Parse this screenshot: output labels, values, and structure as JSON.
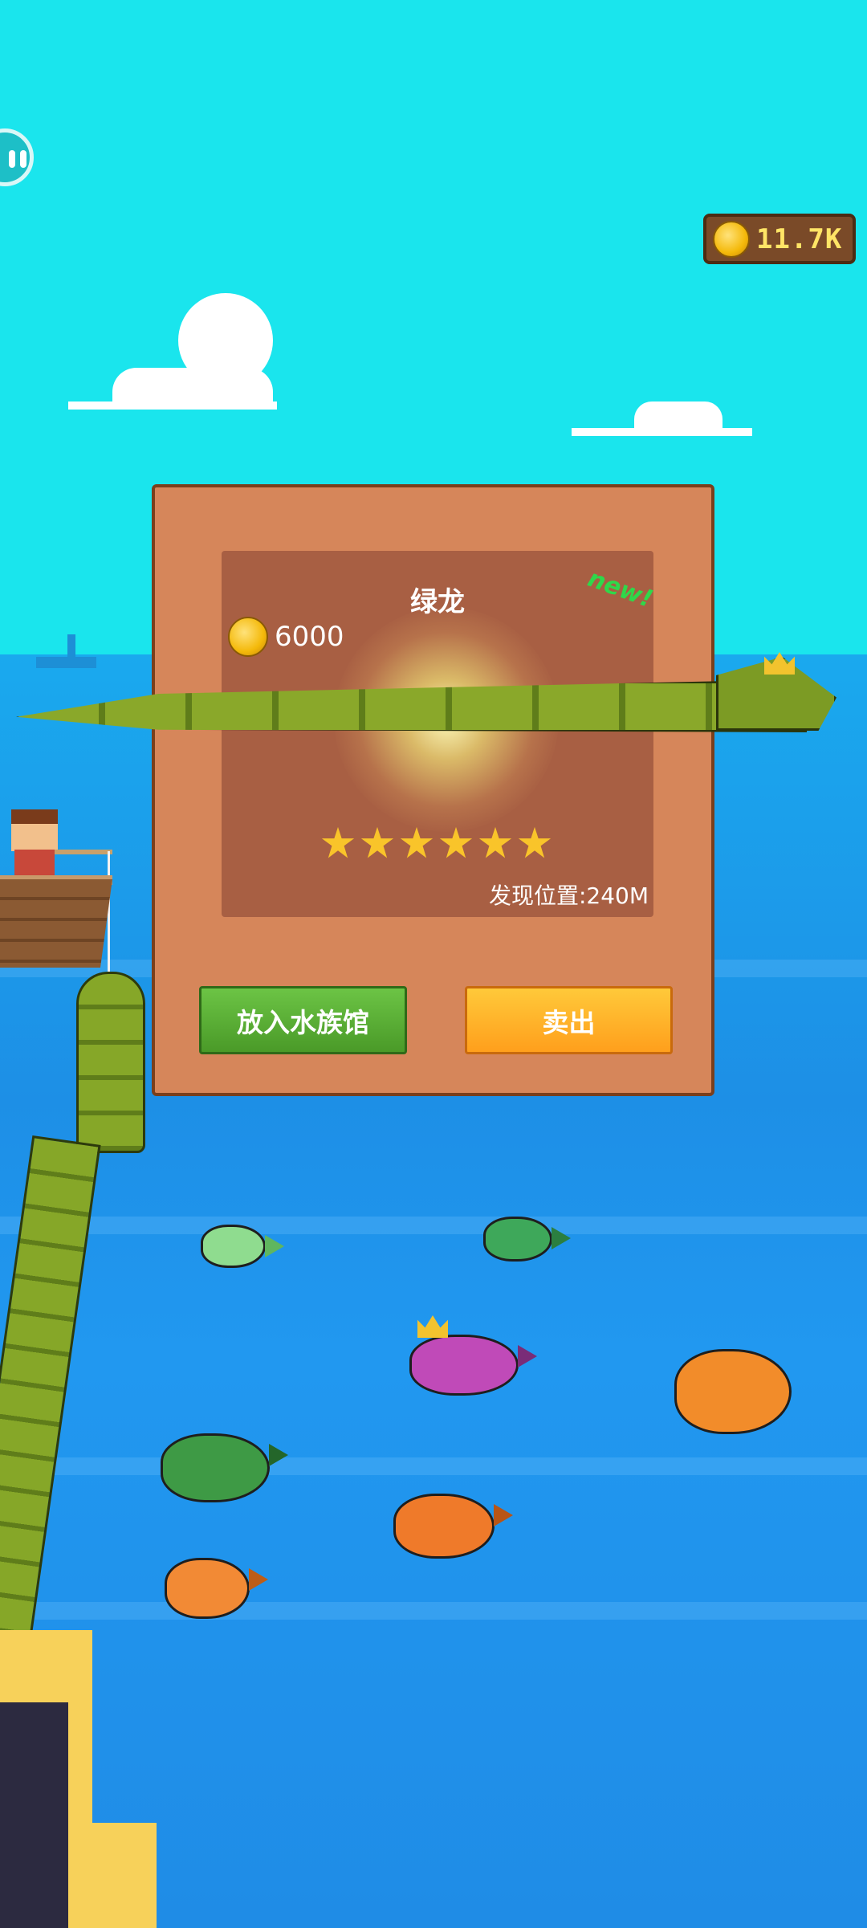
{
  "hud": {
    "coins": "11.7K"
  },
  "catch_dialog": {
    "fish_name": "绿龙",
    "new_tag": "new!",
    "price": "6000",
    "stars": 6,
    "location": "发现位置:240M",
    "buttons": {
      "aquarium": "放入水族馆",
      "sell": "卖出"
    }
  },
  "colors": {
    "sky": "#1ae5ed",
    "sea": "#1d8fe6",
    "dialog_bg": "#d6865a",
    "dialog_inner": "#a85f43",
    "button_green": "#5aae35",
    "button_orange": "#ffb02a",
    "coin_text": "#ffe566"
  },
  "icons": {
    "coin": "coin-icon",
    "star": "star-icon",
    "crown": "crown-icon",
    "avatar": "avatar-icon"
  }
}
